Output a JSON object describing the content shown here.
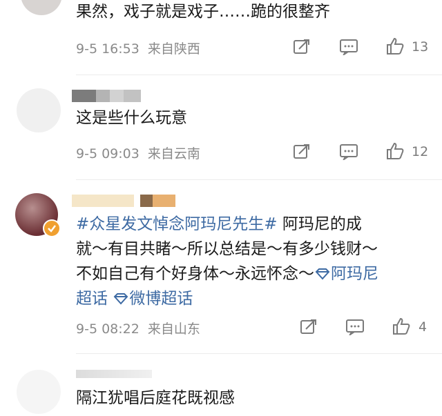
{
  "comments": [
    {
      "text": "果然，戏子就是戏子……跪的很整齐",
      "time": "9-5 16:53",
      "source": "来自陕西",
      "likes": "13"
    },
    {
      "text": "这是些什么玩意",
      "time": "9-5 09:03",
      "source": "来自云南",
      "likes": "12"
    },
    {
      "text_line1_link": "#众星发文悼念阿玛尼先生#",
      "text_line1_rest": "阿玛尼的成",
      "text_line2": "就～有目共睹～所以总结是～有多少钱财～",
      "text_line3_plain": "不如自己有个好身体～永远怀念～",
      "text_line3_link": "阿玛尼",
      "text_line4_link1": "超话",
      "text_line4_link2": "微博超话",
      "time": "9-5 08:22",
      "source": "来自山东",
      "likes": "4"
    },
    {
      "text": "隔江犹唱后庭花既视感"
    }
  ],
  "icons": {
    "share": "share-edit-icon",
    "comment": "comment-icon",
    "like": "thumb-up-icon",
    "verified": "verified-badge-icon",
    "topic": "diamond-topic-icon"
  },
  "colors": {
    "link": "#3d6aa3",
    "verified": "#f0a030"
  }
}
